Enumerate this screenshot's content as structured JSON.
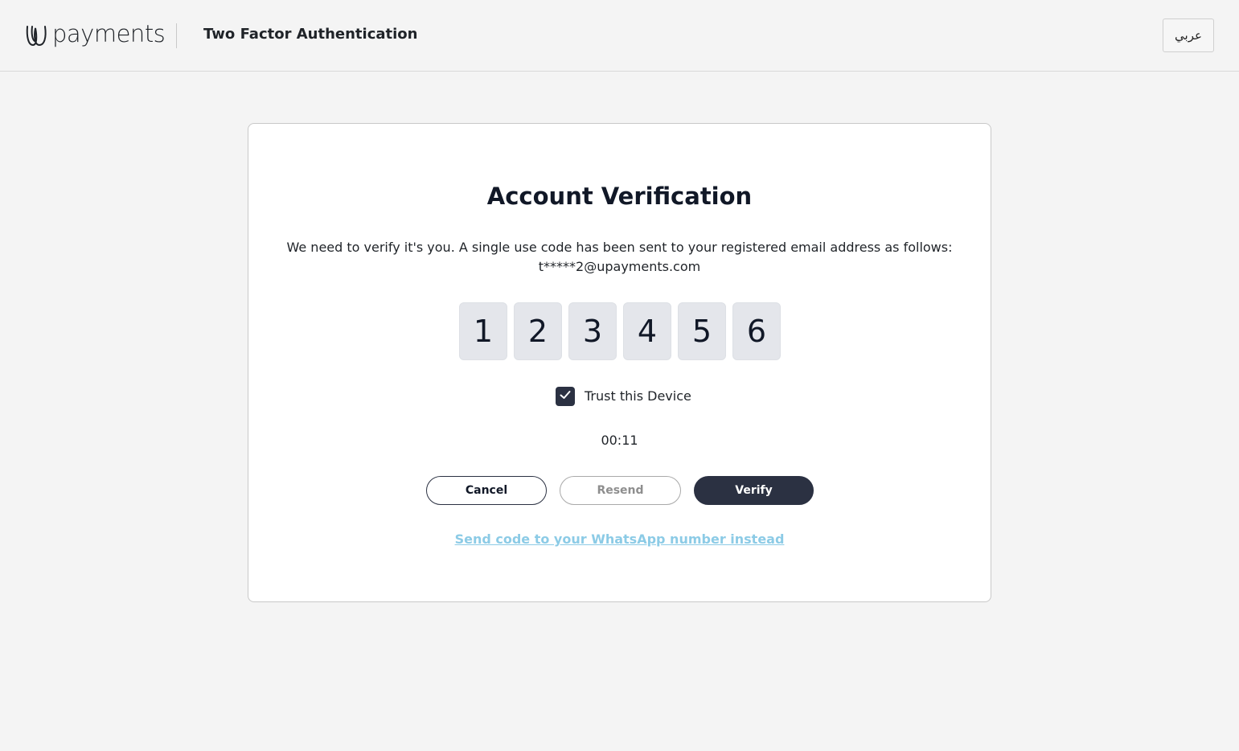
{
  "header": {
    "logo_text": "payments",
    "title": "Two Factor Authentication",
    "language_button_label": "عربي"
  },
  "card": {
    "title": "Account Verification",
    "description_line1": "We need to verify it's you. A single use code has been sent to your registered email address as follows:",
    "email": "t*****2@upayments.com",
    "otp_digits": [
      "1",
      "2",
      "3",
      "4",
      "5",
      "6"
    ],
    "trust_device_label": "Trust this Device",
    "trust_device_checked": true,
    "timer": "00:11",
    "buttons": {
      "cancel": "Cancel",
      "resend": "Resend",
      "verify": "Verify"
    },
    "whatsapp_link": "Send code to your WhatsApp number instead"
  },
  "colors": {
    "primary_dark": "#2b3142",
    "link": "#8ccbe6",
    "otp_box": "#e4e6eb",
    "background": "#f4f4f4"
  },
  "icons": {
    "logo": "upayments-logo-icon",
    "checkbox": "checkmark-icon"
  }
}
